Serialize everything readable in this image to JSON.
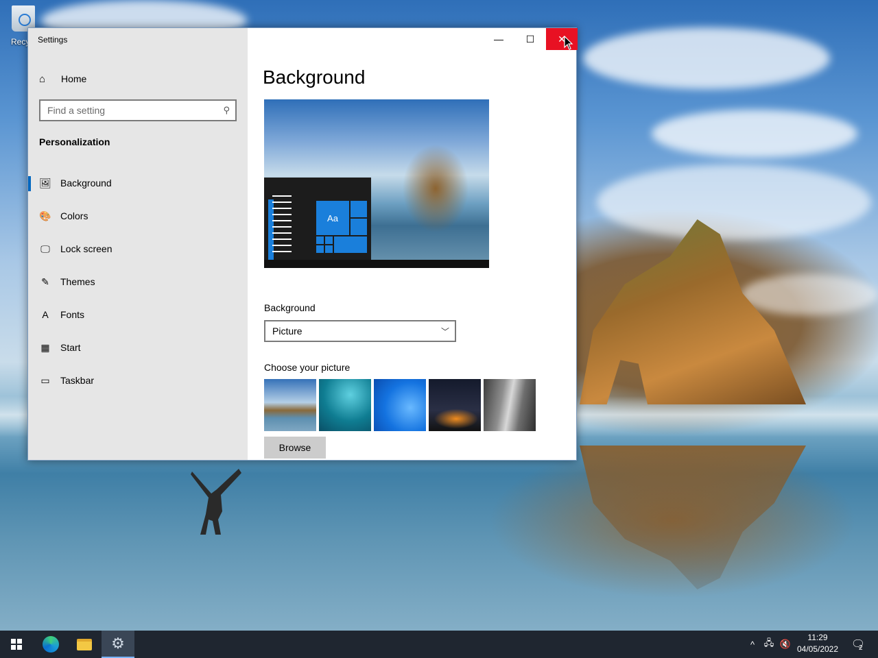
{
  "desktop": {
    "recycle_bin_label": "Recycl"
  },
  "window": {
    "title": "Settings",
    "minimize_glyph": "—",
    "maximize_glyph": "☐",
    "close_glyph": "✕"
  },
  "sidebar": {
    "home_label": "Home",
    "search_placeholder": "Find a setting",
    "section_title": "Personalization",
    "items": [
      {
        "label": "Background",
        "icon": "image-icon",
        "glyph": "🖼",
        "active": true
      },
      {
        "label": "Colors",
        "icon": "palette-icon",
        "glyph": "🎨",
        "active": false
      },
      {
        "label": "Lock screen",
        "icon": "lock-screen-icon",
        "glyph": "🖵",
        "active": false
      },
      {
        "label": "Themes",
        "icon": "brush-icon",
        "glyph": "✎",
        "active": false
      },
      {
        "label": "Fonts",
        "icon": "font-icon",
        "glyph": "A",
        "active": false
      },
      {
        "label": "Start",
        "icon": "start-icon",
        "glyph": "▦",
        "active": false
      },
      {
        "label": "Taskbar",
        "icon": "taskbar-icon",
        "glyph": "▭",
        "active": false
      }
    ]
  },
  "content": {
    "page_title": "Background",
    "preview_tile_text": "Aa",
    "background_label": "Background",
    "background_value": "Picture",
    "choose_label": "Choose your picture",
    "browse_label": "Browse"
  },
  "taskbar": {
    "time": "11:29",
    "date": "04/05/2022",
    "notification_count": "2"
  },
  "colors": {
    "accent": "#0067c0",
    "close_red": "#e81123",
    "sidebar_bg": "#e6e6e6",
    "taskbar_bg": "#1f2630"
  }
}
